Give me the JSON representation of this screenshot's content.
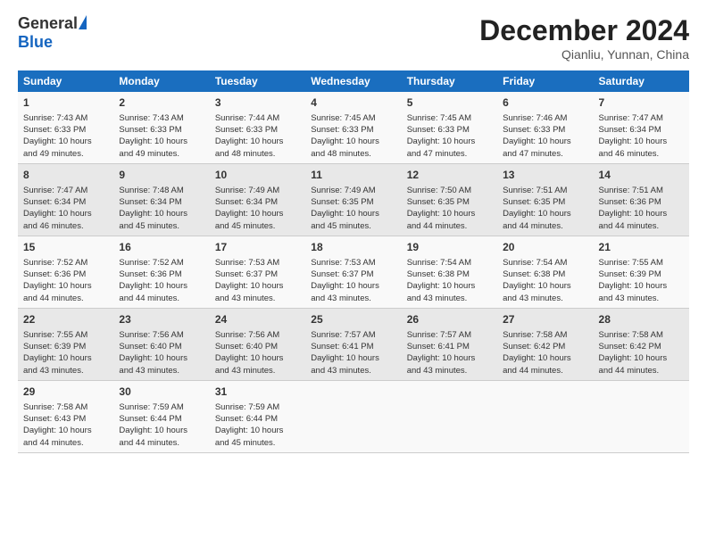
{
  "header": {
    "logo_general": "General",
    "logo_blue": "Blue",
    "month_title": "December 2024",
    "location": "Qianliu, Yunnan, China"
  },
  "weekdays": [
    "Sunday",
    "Monday",
    "Tuesday",
    "Wednesday",
    "Thursday",
    "Friday",
    "Saturday"
  ],
  "weeks": [
    [
      {
        "day": "1",
        "lines": [
          "Sunrise: 7:43 AM",
          "Sunset: 6:33 PM",
          "Daylight: 10 hours",
          "and 49 minutes."
        ]
      },
      {
        "day": "2",
        "lines": [
          "Sunrise: 7:43 AM",
          "Sunset: 6:33 PM",
          "Daylight: 10 hours",
          "and 49 minutes."
        ]
      },
      {
        "day": "3",
        "lines": [
          "Sunrise: 7:44 AM",
          "Sunset: 6:33 PM",
          "Daylight: 10 hours",
          "and 48 minutes."
        ]
      },
      {
        "day": "4",
        "lines": [
          "Sunrise: 7:45 AM",
          "Sunset: 6:33 PM",
          "Daylight: 10 hours",
          "and 48 minutes."
        ]
      },
      {
        "day": "5",
        "lines": [
          "Sunrise: 7:45 AM",
          "Sunset: 6:33 PM",
          "Daylight: 10 hours",
          "and 47 minutes."
        ]
      },
      {
        "day": "6",
        "lines": [
          "Sunrise: 7:46 AM",
          "Sunset: 6:33 PM",
          "Daylight: 10 hours",
          "and 47 minutes."
        ]
      },
      {
        "day": "7",
        "lines": [
          "Sunrise: 7:47 AM",
          "Sunset: 6:34 PM",
          "Daylight: 10 hours",
          "and 46 minutes."
        ]
      }
    ],
    [
      {
        "day": "8",
        "lines": [
          "Sunrise: 7:47 AM",
          "Sunset: 6:34 PM",
          "Daylight: 10 hours",
          "and 46 minutes."
        ]
      },
      {
        "day": "9",
        "lines": [
          "Sunrise: 7:48 AM",
          "Sunset: 6:34 PM",
          "Daylight: 10 hours",
          "and 45 minutes."
        ]
      },
      {
        "day": "10",
        "lines": [
          "Sunrise: 7:49 AM",
          "Sunset: 6:34 PM",
          "Daylight: 10 hours",
          "and 45 minutes."
        ]
      },
      {
        "day": "11",
        "lines": [
          "Sunrise: 7:49 AM",
          "Sunset: 6:35 PM",
          "Daylight: 10 hours",
          "and 45 minutes."
        ]
      },
      {
        "day": "12",
        "lines": [
          "Sunrise: 7:50 AM",
          "Sunset: 6:35 PM",
          "Daylight: 10 hours",
          "and 44 minutes."
        ]
      },
      {
        "day": "13",
        "lines": [
          "Sunrise: 7:51 AM",
          "Sunset: 6:35 PM",
          "Daylight: 10 hours",
          "and 44 minutes."
        ]
      },
      {
        "day": "14",
        "lines": [
          "Sunrise: 7:51 AM",
          "Sunset: 6:36 PM",
          "Daylight: 10 hours",
          "and 44 minutes."
        ]
      }
    ],
    [
      {
        "day": "15",
        "lines": [
          "Sunrise: 7:52 AM",
          "Sunset: 6:36 PM",
          "Daylight: 10 hours",
          "and 44 minutes."
        ]
      },
      {
        "day": "16",
        "lines": [
          "Sunrise: 7:52 AM",
          "Sunset: 6:36 PM",
          "Daylight: 10 hours",
          "and 44 minutes."
        ]
      },
      {
        "day": "17",
        "lines": [
          "Sunrise: 7:53 AM",
          "Sunset: 6:37 PM",
          "Daylight: 10 hours",
          "and 43 minutes."
        ]
      },
      {
        "day": "18",
        "lines": [
          "Sunrise: 7:53 AM",
          "Sunset: 6:37 PM",
          "Daylight: 10 hours",
          "and 43 minutes."
        ]
      },
      {
        "day": "19",
        "lines": [
          "Sunrise: 7:54 AM",
          "Sunset: 6:38 PM",
          "Daylight: 10 hours",
          "and 43 minutes."
        ]
      },
      {
        "day": "20",
        "lines": [
          "Sunrise: 7:54 AM",
          "Sunset: 6:38 PM",
          "Daylight: 10 hours",
          "and 43 minutes."
        ]
      },
      {
        "day": "21",
        "lines": [
          "Sunrise: 7:55 AM",
          "Sunset: 6:39 PM",
          "Daylight: 10 hours",
          "and 43 minutes."
        ]
      }
    ],
    [
      {
        "day": "22",
        "lines": [
          "Sunrise: 7:55 AM",
          "Sunset: 6:39 PM",
          "Daylight: 10 hours",
          "and 43 minutes."
        ]
      },
      {
        "day": "23",
        "lines": [
          "Sunrise: 7:56 AM",
          "Sunset: 6:40 PM",
          "Daylight: 10 hours",
          "and 43 minutes."
        ]
      },
      {
        "day": "24",
        "lines": [
          "Sunrise: 7:56 AM",
          "Sunset: 6:40 PM",
          "Daylight: 10 hours",
          "and 43 minutes."
        ]
      },
      {
        "day": "25",
        "lines": [
          "Sunrise: 7:57 AM",
          "Sunset: 6:41 PM",
          "Daylight: 10 hours",
          "and 43 minutes."
        ]
      },
      {
        "day": "26",
        "lines": [
          "Sunrise: 7:57 AM",
          "Sunset: 6:41 PM",
          "Daylight: 10 hours",
          "and 43 minutes."
        ]
      },
      {
        "day": "27",
        "lines": [
          "Sunrise: 7:58 AM",
          "Sunset: 6:42 PM",
          "Daylight: 10 hours",
          "and 44 minutes."
        ]
      },
      {
        "day": "28",
        "lines": [
          "Sunrise: 7:58 AM",
          "Sunset: 6:42 PM",
          "Daylight: 10 hours",
          "and 44 minutes."
        ]
      }
    ],
    [
      {
        "day": "29",
        "lines": [
          "Sunrise: 7:58 AM",
          "Sunset: 6:43 PM",
          "Daylight: 10 hours",
          "and 44 minutes."
        ]
      },
      {
        "day": "30",
        "lines": [
          "Sunrise: 7:59 AM",
          "Sunset: 6:44 PM",
          "Daylight: 10 hours",
          "and 44 minutes."
        ]
      },
      {
        "day": "31",
        "lines": [
          "Sunrise: 7:59 AM",
          "Sunset: 6:44 PM",
          "Daylight: 10 hours",
          "and 45 minutes."
        ]
      },
      {
        "day": "",
        "lines": []
      },
      {
        "day": "",
        "lines": []
      },
      {
        "day": "",
        "lines": []
      },
      {
        "day": "",
        "lines": []
      }
    ]
  ]
}
